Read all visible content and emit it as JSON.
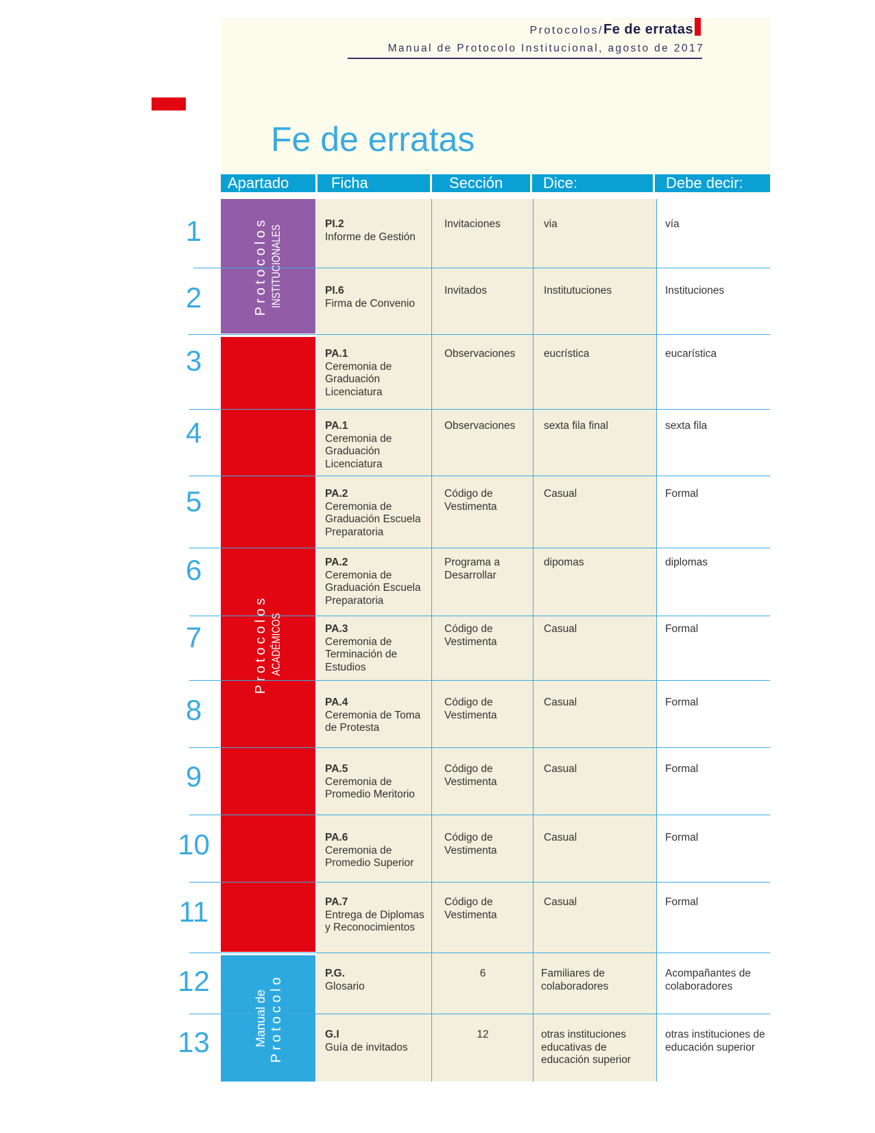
{
  "header": {
    "section": "Protocolos/",
    "doc_name": "Fe de erratas",
    "subtitle": "Manual de Protocolo Institucional, agosto de 2017"
  },
  "title": "Fe de erratas",
  "columns": {
    "apartado": "Apartado",
    "ficha": "Ficha",
    "seccion": "Sección",
    "dice": "Dice:",
    "debe_decir": "Debe decir:"
  },
  "groups": {
    "institucionales": {
      "top": "Protocolos",
      "bottom": "INSTITUCIONALES",
      "color": "#925da6"
    },
    "academicos": {
      "top": "Protocolos",
      "bottom": "ACADÉMICOS",
      "color": "#e20613"
    },
    "manual": {
      "top": "Manual de",
      "bottom": "Protocolo",
      "color": "#2ea9e0"
    }
  },
  "rows": [
    {
      "num": "1",
      "code": "PI.2",
      "name": "Informe de Gestión",
      "seccion": "Invitaciones",
      "dice": "via",
      "debe": "vía"
    },
    {
      "num": "2",
      "code": "PI.6",
      "name": "Firma de Convenio",
      "seccion": "Invitados",
      "dice": "Institutuciones",
      "debe": "Instituciones"
    },
    {
      "num": "3",
      "code": "PA.1",
      "name": "Ceremonia de Graduación Licenciatura",
      "seccion": "Observaciones",
      "dice": "eucrística",
      "debe": "eucarística"
    },
    {
      "num": "4",
      "code": "PA.1",
      "name": "Ceremonia de Graduación Licenciatura",
      "seccion": "Observaciones",
      "dice": "sexta fila final",
      "debe": "sexta fila"
    },
    {
      "num": "5",
      "code": "PA.2",
      "name": "Ceremonia de Graduación Escuela Preparatoria",
      "seccion": "Código de Vestimenta",
      "dice": "Casual",
      "debe": "Formal"
    },
    {
      "num": "6",
      "code": "PA.2",
      "name": "Ceremonia de Graduación Escuela Preparatoria",
      "seccion": "Programa a Desarrollar",
      "dice": "dipomas",
      "debe": "diplomas"
    },
    {
      "num": "7",
      "code": "PA.3",
      "name": "Ceremonia de Terminación de Estudios",
      "seccion": "Código de Vestimenta",
      "dice": "Casual",
      "debe": "Formal"
    },
    {
      "num": "8",
      "code": "PA.4",
      "name": "Ceremonia de Toma de Protesta",
      "seccion": "Código de Vestimenta",
      "dice": "Casual",
      "debe": "Formal"
    },
    {
      "num": "9",
      "code": "PA.5",
      "name": "Ceremonia de Promedio Meritorio",
      "seccion": "Código de Vestimenta",
      "dice": "Casual",
      "debe": "Formal"
    },
    {
      "num": "10",
      "code": "PA.6",
      "name": "Ceremonia de Promedio Superior",
      "seccion": "Código de Vestimenta",
      "dice": "Casual",
      "debe": "Formal"
    },
    {
      "num": "11",
      "code": "PA.7",
      "name": "Entrega de Diplomas y Reconocimientos",
      "seccion": "Código de Vestimenta",
      "dice": "Casual",
      "debe": "Formal"
    },
    {
      "num": "12",
      "code": "P.G.",
      "name": "Glosario",
      "seccion": "6",
      "dice": "Familiares de colaboradores",
      "debe": "Acompañantes de colaboradores"
    },
    {
      "num": "13",
      "code": "G.I",
      "name": "Guía de invitados",
      "seccion": "12",
      "dice": "otras instituciones educativas de educación superior",
      "debe": "otras instituciones de educación superior"
    }
  ]
}
